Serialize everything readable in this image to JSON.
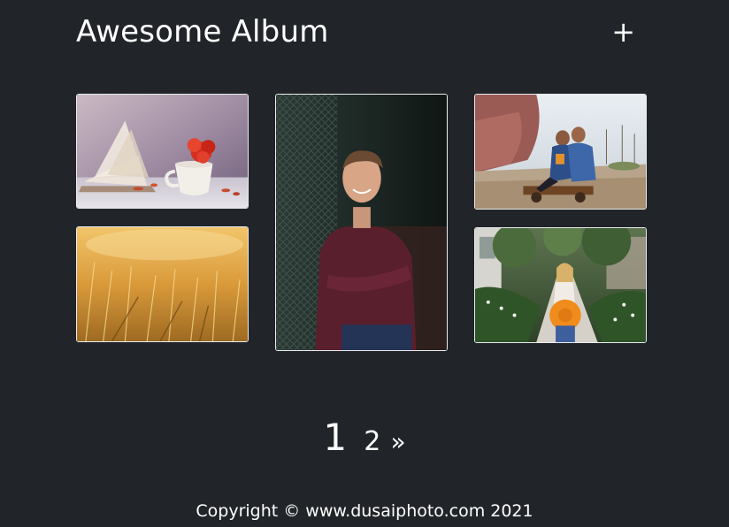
{
  "header": {
    "title": "Awesome Album",
    "add_label": "+"
  },
  "gallery": {
    "photos": [
      {
        "subject": "teacup with red flower and open book",
        "icon": "photo-tea"
      },
      {
        "subject": "golden wheat field",
        "icon": "photo-wheat"
      },
      {
        "subject": "smiling man in maroon sweater leaning on fence",
        "icon": "photo-man"
      },
      {
        "subject": "two boys hugging on a wooden cart",
        "icon": "photo-kids"
      },
      {
        "subject": "girl holding orange hat on garden path",
        "icon": "photo-girl"
      }
    ]
  },
  "pagination": {
    "current": "1",
    "next_page": "2",
    "next_arrow": "»"
  },
  "footer": {
    "copyright": "Copyright © www.dusaiphoto.com 2021"
  }
}
